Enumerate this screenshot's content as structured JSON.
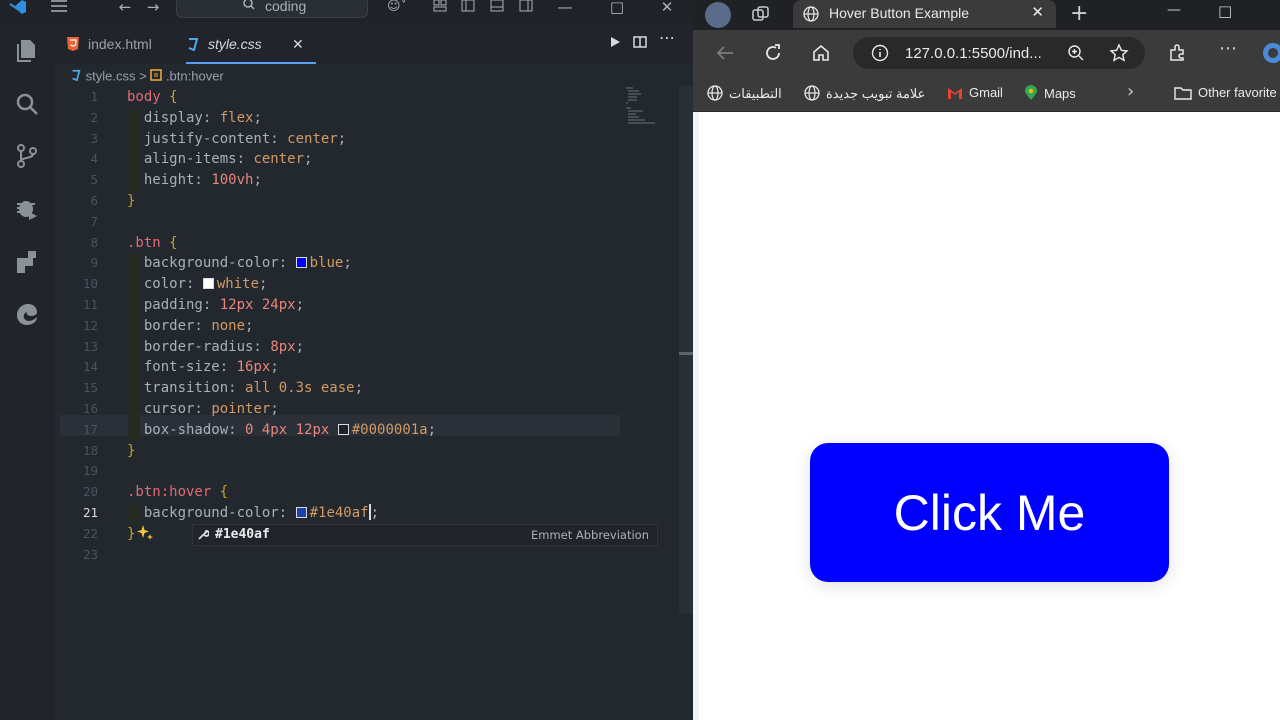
{
  "colors": {
    "accent": "#5a9bf5",
    "button_bg": "#0000ff",
    "button_text": "#ffffff"
  },
  "vscode": {
    "search_text": "coding",
    "tabs": [
      {
        "label": "index.html",
        "icon": "html5-icon"
      },
      {
        "label": "style.css",
        "icon": "css-icon",
        "active": true
      }
    ],
    "breadcrumb": {
      "file": "style.css",
      "separator": ">",
      "symbol": ".btn:hover"
    },
    "line_numbers": [
      "1",
      "2",
      "3",
      "4",
      "5",
      "6",
      "7",
      "8",
      "9",
      "10",
      "11",
      "12",
      "13",
      "14",
      "15",
      "16",
      "17",
      "18",
      "19",
      "20",
      "21",
      "22",
      "23"
    ],
    "active_line": "21",
    "code": {
      "l1_sel": "body",
      "l1_brace": "{",
      "l2_prop": "display:",
      "l2_val": "flex",
      "l2_end": ";",
      "l3_prop": "justify-content:",
      "l3_val": "center",
      "l3_end": ";",
      "l4_prop": "align-items:",
      "l4_val": "center",
      "l4_end": ";",
      "l5_prop": "height:",
      "l5_val": "100vh",
      "l5_end": ";",
      "l6_brace": "}",
      "l8_sel": ".btn",
      "l8_brace": "{",
      "l9_prop": "background-color:",
      "l9_val": "blue",
      "l9_end": ";",
      "l10_prop": "color:",
      "l10_val": "white",
      "l10_end": ";",
      "l11_prop": "padding:",
      "l11_val": "12px 24px",
      "l11_end": ";",
      "l12_prop": "border:",
      "l12_val": "none",
      "l12_end": ";",
      "l13_prop": "border-radius:",
      "l13_val": "8px",
      "l13_end": ";",
      "l14_prop": "font-size:",
      "l14_val": "16px",
      "l14_end": ";",
      "l15_prop": "transition:",
      "l15_val": "all 0.3s ease",
      "l15_end": ";",
      "l16_prop": "cursor:",
      "l16_val": "pointer",
      "l16_end": ";",
      "l17_prop": "box-shadow:",
      "l17_val1": "0 4px 12px",
      "l17_val2": "#0000001a",
      "l17_end": ";",
      "l18_brace": "}",
      "l20_sel": ".btn:hover",
      "l20_brace": "{",
      "l21_prop": "background-color:",
      "l21_val": "#1e40af",
      "l21_end": ";",
      "l22_brace": "}"
    },
    "swatches": {
      "blue": "#0000ff",
      "white": "#ffffff",
      "shadow": "#1e2228",
      "hover": "#1e40af"
    },
    "suggestion": {
      "label": "#1e40af",
      "detail": "Emmet Abbreviation"
    }
  },
  "browser": {
    "tab_title": "Hover Button Example",
    "url": "127.0.0.1:5500/ind...",
    "favorites": [
      {
        "label": "التطبيقات",
        "icon": "globe-icon"
      },
      {
        "label": "علامة تبويب جديدة",
        "icon": "globe-icon"
      },
      {
        "label": "Gmail",
        "icon": "gmail-icon"
      },
      {
        "label": "Maps",
        "icon": "maps-icon"
      },
      {
        "label": "Other favorite",
        "icon": "folder-icon"
      }
    ],
    "page_button": "Click Me"
  }
}
